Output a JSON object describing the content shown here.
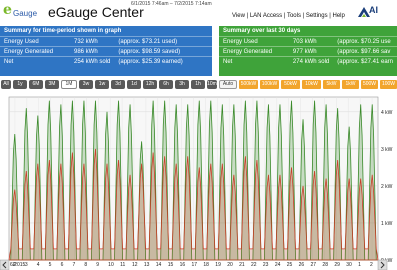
{
  "header": {
    "logo_e": "e",
    "logo_text": "Gauge",
    "title": "eGauge Center",
    "date_range": "6/1/2015 7:46am – 7/2/2015 7:14am",
    "nav": [
      "View",
      "LAN Access",
      "Tools",
      "Settings",
      "Help"
    ],
    "nav_separator": " | ",
    "brand": "AI"
  },
  "summary_graph": {
    "title": "Summary for time-period shown in graph",
    "rows": [
      {
        "label": "Energy Used",
        "value": "732 kWh",
        "note": "(approx. $73.21 used)"
      },
      {
        "label": "Energy Generated",
        "value": "986 kWh",
        "note": "(approx. $98.59 saved)"
      },
      {
        "label": "Net",
        "value": "254 kWh sold",
        "note": "(approx. $25.39 earned)"
      }
    ]
  },
  "summary_30": {
    "title": "Summary over last 30 days",
    "rows": [
      {
        "label": "Energy Used",
        "value": "703 kWh",
        "note": "(approx. $70.25 use"
      },
      {
        "label": "Energy Generated",
        "value": "977 kWh",
        "note": "(approx. $97.66 sav"
      },
      {
        "label": "Net",
        "value": "274 kWh sold",
        "note": "(approx. $27.41 earn"
      }
    ]
  },
  "toolbar": {
    "range_buttons": [
      "All",
      "1y",
      "6M",
      "3M",
      "1M",
      "3w",
      "1w",
      "3d",
      "1d",
      "12h",
      "6h",
      "3h",
      "1h",
      "10m"
    ],
    "selected": "1M",
    "auto_label": "Auto",
    "scale_buttons": [
      "500kW",
      "100kW",
      "50kW",
      "10kW",
      "5kW",
      "1kW",
      "500W",
      "100W"
    ]
  },
  "chart_data": {
    "type": "area",
    "y_ticks": [
      "4 kW",
      "3 kW",
      "2 kW",
      "1 kW",
      "0 kW"
    ],
    "ylim": [
      0,
      4.4
    ],
    "x_ticks": [
      "2",
      "3",
      "4",
      "5",
      "6",
      "7",
      "8",
      "9",
      "10",
      "11",
      "12",
      "13",
      "14",
      "15",
      "16",
      "17",
      "18",
      "19",
      "20",
      "21",
      "22",
      "23",
      "24",
      "25",
      "26",
      "27",
      "28",
      "29",
      "30",
      "1",
      "2"
    ],
    "x_first_label": "6/2015",
    "series": [
      {
        "color": "#3a8a2a",
        "values": [
          3.4,
          4.1,
          3.9,
          4.3,
          4.2,
          4.3,
          4.3,
          4.3,
          4.0,
          4.3,
          4.2,
          3.2,
          4.3,
          4.3,
          4.2,
          4.2,
          4.3,
          4.3,
          4.2,
          4.2,
          4.3,
          4.3,
          4.2,
          4.2,
          4.3,
          3.8,
          4.3,
          4.2,
          4.1,
          3.6,
          4.2,
          4.2
        ]
      },
      {
        "color": "#c8402a",
        "values": [
          1.9,
          2.4,
          2.6,
          2.7,
          2.6,
          2.9,
          2.6,
          3.0,
          2.6,
          2.7,
          2.3,
          2.6,
          2.9,
          2.8,
          2.6,
          2.8,
          2.5,
          2.6,
          2.6,
          2.3,
          2.8,
          2.7,
          2.3,
          2.3,
          2.5,
          2.0,
          2.4,
          2.2,
          2.7,
          2.2,
          2.2,
          2.3
        ]
      }
    ]
  },
  "colors": {
    "generated": "#3a8a2a",
    "used": "#c8402a",
    "panel_left": "#2f75c4",
    "panel_right": "#3fa33a",
    "scale_btn": "#f2a52c"
  }
}
